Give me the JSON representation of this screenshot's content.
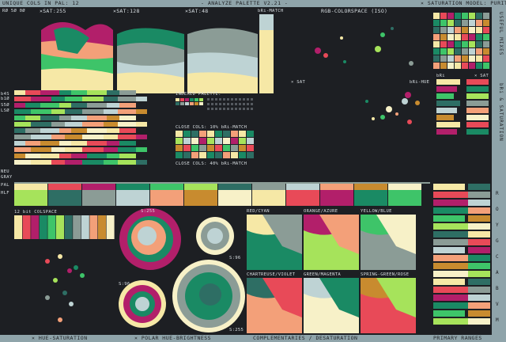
{
  "header": {
    "left": "UNIQUE COLS IN PAL: 12",
    "center": "- ANALYZE PALETTE V2.21 -",
    "right": "× SATURATION MODEL: PURITY"
  },
  "sub_header": {
    "sat_a": "×SAT:255",
    "sat_b": "×SAT:128",
    "sat_c": "×SAT:48",
    "bri": "bRi-MATCH",
    "rgb": "RGB-COLORSPACE (ISO)",
    "ticks": "RØ 5Ø 0Ø"
  },
  "labels": {
    "sat": "× SAT",
    "bri_hue": "bRi-HUE",
    "bri": "bRi",
    "sat2": "× SAT",
    "indexed": "INDEXED PALETTE:",
    "close1": "CLOSE COLS: 10% bRi-MATCH",
    "close2": "CLOSE COLS: 40% bRi-MATCH",
    "colspace": "12 bit COLSPACE",
    "s255a": "S:255",
    "s96a": "S:96",
    "s96b": "S:96",
    "s255b": "S:255",
    "neu": "NEU",
    "gray": "GRAY",
    "pal": "PAL",
    "hlf": "HLF",
    "b4": "b4S",
    "b10": "b1Ø",
    "s50": "S5Ø",
    "ls0": "LSØ"
  },
  "pairs": [
    {
      "label": "RED/CYAN"
    },
    {
      "label": "ORANGE/AZURE"
    },
    {
      "label": "YELLOW/BLUE"
    },
    {
      "label": "CHARTREUSE/VIOLET"
    },
    {
      "label": "GREEN/MAGENTA"
    },
    {
      "label": "SPRING-GREEN/ROSE"
    }
  ],
  "side_right": {
    "title": "USEFUL MIXES",
    "sub": "bRi & SATURATION",
    "letters": [
      "R",
      "O",
      "Y",
      "G",
      "C",
      "A",
      "B",
      "V",
      "M"
    ]
  },
  "footer": {
    "a": "× HUE-SATURATION",
    "b": "× POLAR HUE-BRIGHTNESS",
    "c": "COMPLEMENTARIES / DESATURATION",
    "d": "PRIMARY RANGES"
  },
  "palette": [
    "#f6e8a6",
    "#e84a58",
    "#b21f6a",
    "#1a8a64",
    "#3ec469",
    "#a6e35b",
    "#2e6e64",
    "#8b9c96",
    "#bed3d4",
    "#f3a079",
    "#c88b2f",
    "#f7f1c8"
  ]
}
